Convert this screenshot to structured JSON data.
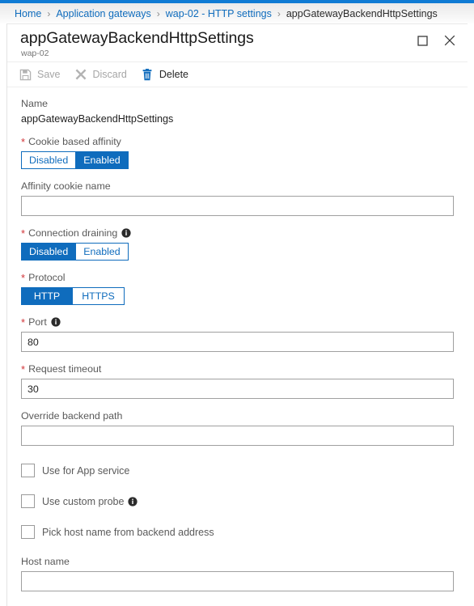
{
  "breadcrumb": {
    "separator": "›",
    "items": [
      {
        "label": "Home",
        "current": false
      },
      {
        "label": "Application gateways",
        "current": false
      },
      {
        "label": "wap-02 - HTTP settings",
        "current": false
      },
      {
        "label": "appGatewayBackendHttpSettings",
        "current": true
      }
    ]
  },
  "header": {
    "title": "appGatewayBackendHttpSettings",
    "subtitle": "wap-02",
    "maximize_icon": "maximize-icon",
    "close_icon": "close-icon"
  },
  "toolbar": {
    "save": {
      "label": "Save",
      "icon": "save-icon",
      "enabled": false
    },
    "discard": {
      "label": "Discard",
      "icon": "discard-icon",
      "enabled": false
    },
    "delete": {
      "label": "Delete",
      "icon": "delete-icon",
      "enabled": true
    }
  },
  "form": {
    "name": {
      "label": "Name",
      "value": "appGatewayBackendHttpSettings"
    },
    "cookie_affinity": {
      "label": "Cookie based affinity",
      "required": true,
      "options": [
        "Disabled",
        "Enabled"
      ],
      "selected": "Enabled"
    },
    "affinity_cookie_name": {
      "label": "Affinity cookie name",
      "value": "",
      "placeholder": ""
    },
    "connection_draining": {
      "label": "Connection draining",
      "required": true,
      "has_info": true,
      "options": [
        "Disabled",
        "Enabled"
      ],
      "selected": "Disabled"
    },
    "protocol": {
      "label": "Protocol",
      "required": true,
      "options": [
        "HTTP",
        "HTTPS"
      ],
      "selected": "HTTP"
    },
    "port": {
      "label": "Port",
      "required": true,
      "has_info": true,
      "value": "80"
    },
    "request_timeout": {
      "label": "Request timeout",
      "required": true,
      "value": "30"
    },
    "override_backend_path": {
      "label": "Override backend path",
      "value": "",
      "placeholder": ""
    },
    "use_for_app_service": {
      "label": "Use for App service",
      "checked": false
    },
    "use_custom_probe": {
      "label": "Use custom probe",
      "has_info": true,
      "checked": false
    },
    "pick_host_name": {
      "label": "Pick host name from backend address",
      "checked": false
    },
    "host_name": {
      "label": "Host name",
      "value": "",
      "placeholder": ""
    }
  },
  "colors": {
    "accent": "#0f7bd4",
    "toggle_selected": "#0f6cbd",
    "link": "#0f6cbd",
    "required_asterisk": "#d13438",
    "delete_icon": "#0f6cbd"
  }
}
